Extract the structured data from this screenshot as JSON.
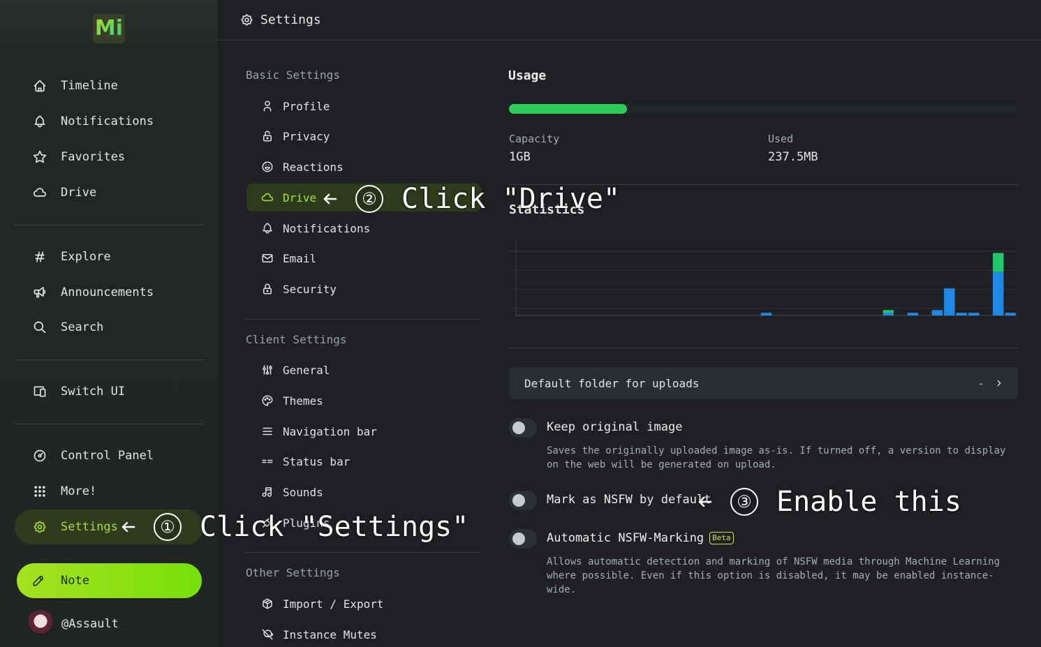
{
  "header": {
    "title": "Settings"
  },
  "nav": {
    "items": [
      {
        "label": "Timeline",
        "icon": "home-icon"
      },
      {
        "label": "Notifications",
        "icon": "bell-icon"
      },
      {
        "label": "Favorites",
        "icon": "star-icon"
      },
      {
        "label": "Drive",
        "icon": "cloud-icon"
      },
      {
        "label": "Explore",
        "icon": "hash-icon"
      },
      {
        "label": "Announcements",
        "icon": "speakerphone-icon"
      },
      {
        "label": "Search",
        "icon": "search-icon"
      },
      {
        "label": "Switch UI",
        "icon": "devices-icon"
      },
      {
        "label": "Control Panel",
        "icon": "dashboard-icon"
      },
      {
        "label": "More!",
        "icon": "grid-dots-icon"
      },
      {
        "label": "Settings",
        "icon": "gear-icon",
        "active": true
      }
    ],
    "note_label": "Note",
    "account": "@Assault"
  },
  "menu": {
    "basic_heading": "Basic Settings",
    "basic": [
      {
        "label": "Profile",
        "icon": "user-icon"
      },
      {
        "label": "Privacy",
        "icon": "lock-open-icon"
      },
      {
        "label": "Reactions",
        "icon": "mood-happy-icon"
      },
      {
        "label": "Drive",
        "icon": "cloud-icon",
        "active": true
      },
      {
        "label": "Notifications",
        "icon": "bell-icon"
      },
      {
        "label": "Email",
        "icon": "mail-icon"
      },
      {
        "label": "Security",
        "icon": "lock-icon"
      }
    ],
    "client_heading": "Client Settings",
    "client": [
      {
        "label": "General",
        "icon": "adjustments-icon"
      },
      {
        "label": "Themes",
        "icon": "palette-icon"
      },
      {
        "label": "Navigation bar",
        "icon": "list-icon"
      },
      {
        "label": "Status bar",
        "icon": "status-bar-icon"
      },
      {
        "label": "Sounds",
        "icon": "music-icon"
      },
      {
        "label": "Plugins",
        "icon": "plug-icon"
      }
    ],
    "other_heading": "Other Settings",
    "other": [
      {
        "label": "Import / Export",
        "icon": "package-icon"
      },
      {
        "label": "Instance Mutes",
        "icon": "planet-off-icon"
      }
    ]
  },
  "drive": {
    "usage_title": "Usage",
    "usage_fraction": 0.232,
    "usage_color": "#2ecc5a",
    "capacity_label": "Capacity",
    "capacity_value": "1GB",
    "used_label": "Used",
    "used_value": "237.5MB",
    "stats_title": "Statistics",
    "folder_label": "Default folder for uploads",
    "folder_value": "-",
    "keep_original_label": "Keep original image",
    "keep_original_desc": "Saves the originally uploaded image as-is. If turned off, a version to display on the web will be generated on upload.",
    "keep_original_on": false,
    "nsfw_label": "Mark as NSFW by default",
    "nsfw_on": false,
    "auto_nsfw_label": "Automatic NSFW-Marking",
    "auto_nsfw_badge": "Beta",
    "auto_nsfw_desc": "Allows automatic detection and marking of NSFW media through Machine Learning where possible. Even if this option is disabled, it may be enabled instance-wide.",
    "auto_nsfw_on": false
  },
  "chart_data": {
    "type": "bar",
    "series": [
      {
        "values": [
          0,
          0,
          0,
          0,
          0,
          0,
          0,
          0,
          0,
          0,
          0,
          0,
          0,
          0,
          0,
          0,
          0,
          0,
          0,
          0,
          1,
          0,
          0,
          0,
          0,
          0,
          0,
          0,
          0,
          0,
          1,
          0,
          1,
          0,
          2,
          10,
          1,
          1,
          0,
          16,
          1
        ],
        "color": "#1e88e5"
      },
      {
        "values": [
          0,
          0,
          0,
          0,
          0,
          0,
          0,
          0,
          0,
          0,
          0,
          0,
          0,
          0,
          0,
          0,
          0,
          0,
          0,
          0,
          0,
          0,
          0,
          0,
          0,
          0,
          0,
          0,
          0,
          0,
          1,
          0,
          0,
          0,
          0,
          0,
          0,
          0,
          0,
          7,
          0
        ],
        "color": "#22c76a"
      }
    ],
    "grid": true,
    "ylim": [
      0,
      28
    ]
  },
  "annotations": [
    {
      "number": "①",
      "text": "Click \"Settings\""
    },
    {
      "number": "②",
      "text": "Click \"Drive\""
    },
    {
      "number": "③",
      "text": "Enable this"
    }
  ]
}
